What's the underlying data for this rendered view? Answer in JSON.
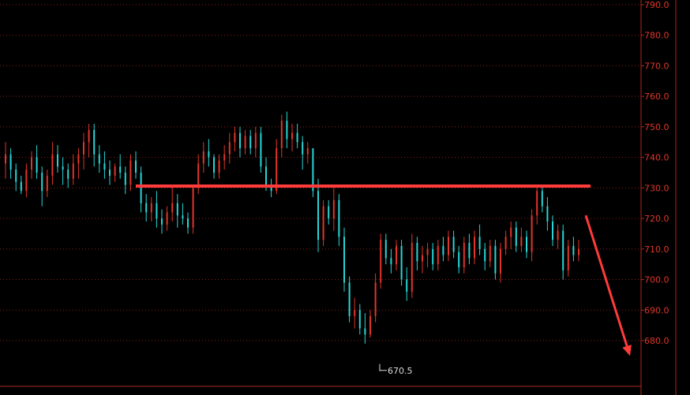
{
  "chart_data": {
    "type": "candlestick",
    "title": "",
    "xlabel": "",
    "ylabel": "",
    "ylim": [
      672,
      792
    ],
    "y_ticks": [
      "790.0",
      "780.0",
      "770.0",
      "760.0",
      "750.0",
      "740.0",
      "730.0",
      "720.0",
      "710.0",
      "700.0",
      "690.0",
      "680.0"
    ],
    "grid": "dotted horizontal",
    "colors": {
      "up": "#e0352b",
      "down": "#27d6d6",
      "axis": "#b02820",
      "grid": "#8a1f1a",
      "annotation": "#ff3b3b",
      "background": "#000000"
    },
    "low_label": "670.5",
    "low_value": 670.5,
    "resistance_level": 730.6,
    "arrow_target": 675,
    "candles": [
      [
        738,
        745,
        733,
        741
      ],
      [
        741,
        743,
        733,
        736
      ],
      [
        736,
        738,
        729,
        732
      ],
      [
        732,
        734,
        728,
        729
      ],
      [
        729,
        738,
        727,
        736
      ],
      [
        736,
        742,
        733,
        740
      ],
      [
        740,
        744,
        733,
        735
      ],
      [
        735,
        737,
        724,
        729
      ],
      [
        729,
        736,
        727,
        734
      ],
      [
        734,
        745,
        731,
        741
      ],
      [
        741,
        744,
        735,
        737
      ],
      [
        737,
        740,
        731,
        736
      ],
      [
        736,
        738,
        730,
        733
      ],
      [
        733,
        741,
        731,
        738
      ],
      [
        738,
        743,
        733,
        741
      ],
      [
        741,
        748,
        736,
        745
      ],
      [
        745,
        751,
        740,
        749
      ],
      [
        749,
        751,
        737,
        741
      ],
      [
        741,
        744,
        735,
        738
      ],
      [
        738,
        742,
        733,
        736
      ],
      [
        736,
        739,
        731,
        734
      ],
      [
        734,
        738,
        732,
        737
      ],
      [
        737,
        741,
        733,
        735
      ],
      [
        735,
        737,
        728,
        731
      ],
      [
        731,
        741,
        729,
        739
      ],
      [
        739,
        742,
        733,
        735
      ],
      [
        735,
        737,
        722,
        725
      ],
      [
        725,
        728,
        719,
        722
      ],
      [
        722,
        727,
        719,
        725
      ],
      [
        725,
        729,
        717,
        720
      ],
      [
        720,
        723,
        715,
        718
      ],
      [
        718,
        724,
        716,
        722
      ],
      [
        722,
        731,
        719,
        725
      ],
      [
        725,
        728,
        717,
        721
      ],
      [
        721,
        725,
        718,
        720
      ],
      [
        720,
        722,
        715,
        717
      ],
      [
        717,
        731,
        715,
        730
      ],
      [
        730,
        741,
        728,
        738
      ],
      [
        738,
        745,
        735,
        742
      ],
      [
        742,
        746,
        737,
        740
      ],
      [
        740,
        741,
        733,
        735
      ],
      [
        735,
        741,
        733,
        739
      ],
      [
        739,
        744,
        736,
        741
      ],
      [
        741,
        748,
        738,
        745
      ],
      [
        745,
        750,
        742,
        748
      ],
      [
        748,
        750,
        740,
        743
      ],
      [
        743,
        749,
        741,
        747
      ],
      [
        747,
        749,
        741,
        743
      ],
      [
        743,
        750,
        740,
        748
      ],
      [
        748,
        750,
        735,
        737
      ],
      [
        737,
        740,
        729,
        731
      ],
      [
        731,
        733,
        727,
        729
      ],
      [
        729,
        746,
        728,
        743
      ],
      [
        743,
        754,
        740,
        752
      ],
      [
        752,
        755,
        743,
        746
      ],
      [
        746,
        751,
        742,
        748
      ],
      [
        748,
        751,
        743,
        745
      ],
      [
        745,
        747,
        736,
        741
      ],
      [
        741,
        745,
        738,
        743
      ],
      [
        743,
        731,
        727,
        729
      ],
      [
        729,
        733,
        709,
        713
      ],
      [
        713,
        726,
        711,
        724
      ],
      [
        724,
        726,
        718,
        720
      ],
      [
        720,
        730,
        716,
        726
      ],
      [
        726,
        728,
        711,
        714
      ],
      [
        714,
        717,
        696,
        699
      ],
      [
        699,
        701,
        686,
        688
      ],
      [
        688,
        694,
        684,
        690
      ],
      [
        690,
        692,
        682,
        684
      ],
      [
        684,
        689,
        679,
        682
      ],
      [
        682,
        690,
        681,
        688
      ],
      [
        688,
        702,
        686,
        699
      ],
      [
        699,
        715,
        697,
        713
      ],
      [
        713,
        715,
        705,
        707
      ],
      [
        707,
        710,
        702,
        705
      ],
      [
        705,
        713,
        703,
        711
      ],
      [
        711,
        713,
        698,
        700
      ],
      [
        700,
        704,
        693,
        696
      ],
      [
        696,
        715,
        694,
        712
      ],
      [
        712,
        714,
        703,
        706
      ],
      [
        706,
        711,
        702,
        708
      ],
      [
        708,
        712,
        704,
        710
      ],
      [
        710,
        712,
        703,
        705
      ],
      [
        705,
        713,
        703,
        711
      ],
      [
        711,
        714,
        706,
        708
      ],
      [
        708,
        716,
        706,
        714
      ],
      [
        714,
        716,
        707,
        709
      ],
      [
        709,
        711,
        702,
        704
      ],
      [
        704,
        714,
        702,
        712
      ],
      [
        712,
        715,
        705,
        707
      ],
      [
        707,
        716,
        705,
        714
      ],
      [
        714,
        718,
        708,
        710
      ],
      [
        710,
        712,
        703,
        706
      ],
      [
        706,
        713,
        704,
        711
      ],
      [
        711,
        713,
        700,
        702
      ],
      [
        702,
        712,
        699,
        710
      ],
      [
        710,
        716,
        708,
        714
      ],
      [
        714,
        719,
        710,
        717
      ],
      [
        717,
        719,
        709,
        711
      ],
      [
        711,
        717,
        709,
        714
      ],
      [
        714,
        716,
        707,
        709
      ],
      [
        709,
        723,
        706,
        721
      ],
      [
        721,
        731,
        718,
        729
      ],
      [
        729,
        731,
        722,
        724
      ],
      [
        724,
        727,
        716,
        719
      ],
      [
        719,
        721,
        711,
        713
      ],
      [
        713,
        718,
        710,
        716
      ],
      [
        716,
        718,
        700,
        703
      ],
      [
        703,
        713,
        701,
        711
      ],
      [
        711,
        714,
        706,
        708
      ],
      [
        708,
        713,
        706,
        710
      ]
    ]
  }
}
